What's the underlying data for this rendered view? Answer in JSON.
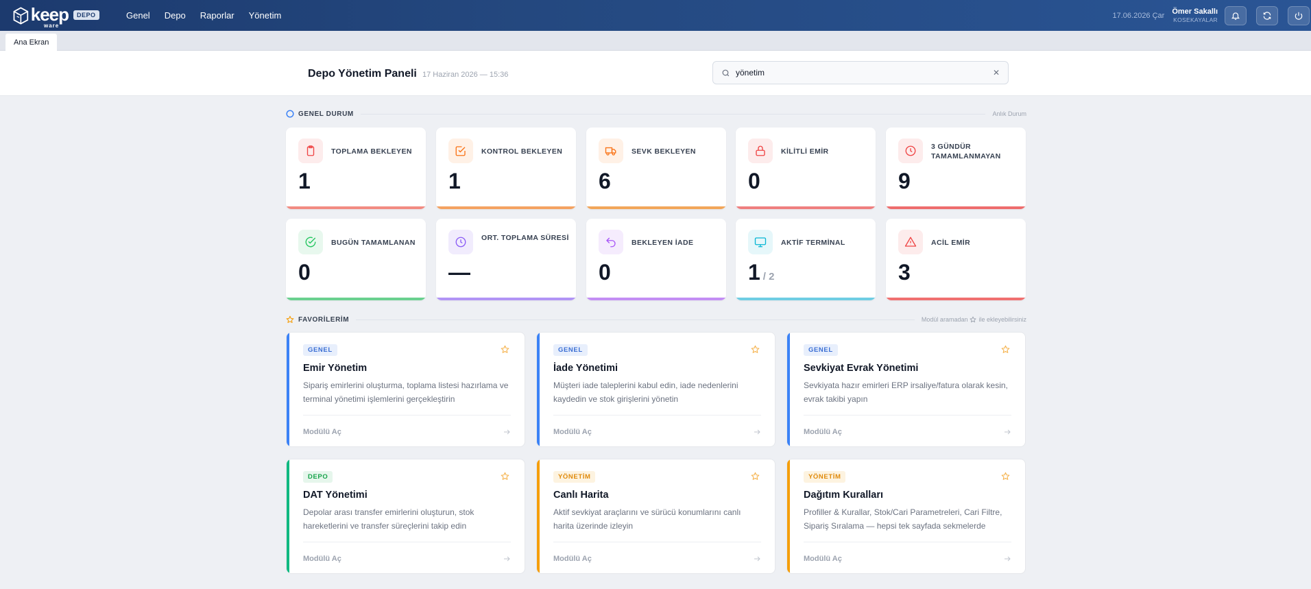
{
  "topbar": {
    "logo_text": "keep",
    "logo_sub": "ware",
    "badge": "DEPO",
    "nav": [
      "Genel",
      "Depo",
      "Raporlar",
      "Yönetim"
    ],
    "date": "17.06.2026 Çar",
    "user_name": "Ömer Sakallı",
    "user_org": "KOSEKAYALAR",
    "icons": [
      "bell-icon",
      "refresh-icon",
      "power-icon"
    ]
  },
  "tabs": [
    "Ana Ekran"
  ],
  "header": {
    "title": "Depo Yönetim Paneli",
    "subtitle": "17 Haziran 2026 — 15:36",
    "search_value": "yönetim",
    "clear_label": "✕"
  },
  "overview": {
    "heading": "GENEL DURUM",
    "right": "Anlık Durum",
    "stats": [
      {
        "label": "TOPLAMA BEKLEYEN",
        "value": "1",
        "icon": "clipboard-icon",
        "color": "#ef4444",
        "bg": "#fdecec",
        "bar": "#f28b82"
      },
      {
        "label": "KONTROL BEKLEYEN",
        "value": "1",
        "icon": "check-square-icon",
        "color": "#f97316",
        "bg": "#fff1e6",
        "bar": "#f4a261"
      },
      {
        "label": "SEVK BEKLEYEN",
        "value": "6",
        "icon": "truck-icon",
        "color": "#f97316",
        "bg": "#fff1e6",
        "bar": "#f2a65a"
      },
      {
        "label": "KİLİTLİ EMİR",
        "value": "0",
        "icon": "lock-icon",
        "color": "#ef4444",
        "bg": "#fdecec",
        "bar": "#ef7f7f"
      },
      {
        "label": "3 GÜNDÜR TAMAMLANMAYAN",
        "value": "9",
        "icon": "clock-icon",
        "color": "#ef4444",
        "bg": "#fdecec",
        "bar": "#ee6d6d"
      },
      {
        "label": "BUGÜN TAMAMLANAN",
        "value": "0",
        "icon": "check-circle-icon",
        "color": "#22c55e",
        "bg": "#e8f8ee",
        "bar": "#6ad08f"
      },
      {
        "label": "ORT. TOPLAMA SÜRESİ",
        "value": "—",
        "icon": "clock-icon",
        "color": "#8b5cf6",
        "bg": "#f1ecfd",
        "bar": "#b194f5"
      },
      {
        "label": "BEKLEYEN İADE",
        "value": "0",
        "icon": "undo-icon",
        "color": "#a855f7",
        "bg": "#f5ecfd",
        "bar": "#c38ef4"
      },
      {
        "label": "AKTİF TERMİNAL",
        "value": "1",
        "of": "/ 2",
        "icon": "monitor-icon",
        "color": "#06b6d4",
        "bg": "#e6f7fa",
        "bar": "#6fcde3"
      },
      {
        "label": "ACİL EMİR",
        "value": "3",
        "icon": "warning-icon",
        "color": "#ef4444",
        "bg": "#fdecec",
        "bar": "#f07070"
      }
    ]
  },
  "favorites": {
    "heading": "FAVORİLERİM",
    "right_pre": "Modül aramadan",
    "right_post": "ile ekleyebilirsiniz",
    "open_label": "Modülü Aç",
    "modules": [
      {
        "tag": "GENEL",
        "title": "Emir Yönetim",
        "desc": "Sipariş emirlerini oluşturma, toplama listesi hazırlama ve terminal yönetimi işlemlerini gerçekleştirin",
        "accent": "#3b82f6",
        "tag_color": "#3b6fd4",
        "tag_bg": "#e8effc"
      },
      {
        "tag": "GENEL",
        "title": "İade Yönetimi",
        "desc": "Müşteri iade taleplerini kabul edin, iade nedenlerini kaydedin ve stok girişlerini yönetin",
        "accent": "#3b82f6",
        "tag_color": "#3b6fd4",
        "tag_bg": "#e8effc"
      },
      {
        "tag": "GENEL",
        "title": "Sevkiyat Evrak Yönetimi",
        "desc": "Sevkiyata hazır emirleri ERP irsaliye/fatura olarak kesin, evrak takibi yapın",
        "accent": "#3b82f6",
        "tag_color": "#3b6fd4",
        "tag_bg": "#e8effc"
      },
      {
        "tag": "DEPO",
        "title": "DAT Yönetimi",
        "desc": "Depolar arası transfer emirlerini oluşturun, stok hareketlerini ve transfer süreçlerini takip edin",
        "accent": "#10b981",
        "tag_color": "#16a34a",
        "tag_bg": "#e6f6ec"
      },
      {
        "tag": "YÖNETİM",
        "title": "Canlı Harita",
        "desc": "Aktif sevkiyat araçlarını ve sürücü konumlarını canlı harita üzerinde izleyin",
        "accent": "#f59e0b",
        "tag_color": "#e08a0b",
        "tag_bg": "#fdf3e0"
      },
      {
        "tag": "YÖNETİM",
        "title": "Dağıtım Kuralları",
        "desc": "Profiller & Kurallar, Stok/Cari Parametreleri, Cari Filtre, Sipariş Sıralama — hepsi tek sayfada sekmelerde",
        "accent": "#f59e0b",
        "tag_color": "#e08a0b",
        "tag_bg": "#fdf3e0"
      }
    ]
  }
}
